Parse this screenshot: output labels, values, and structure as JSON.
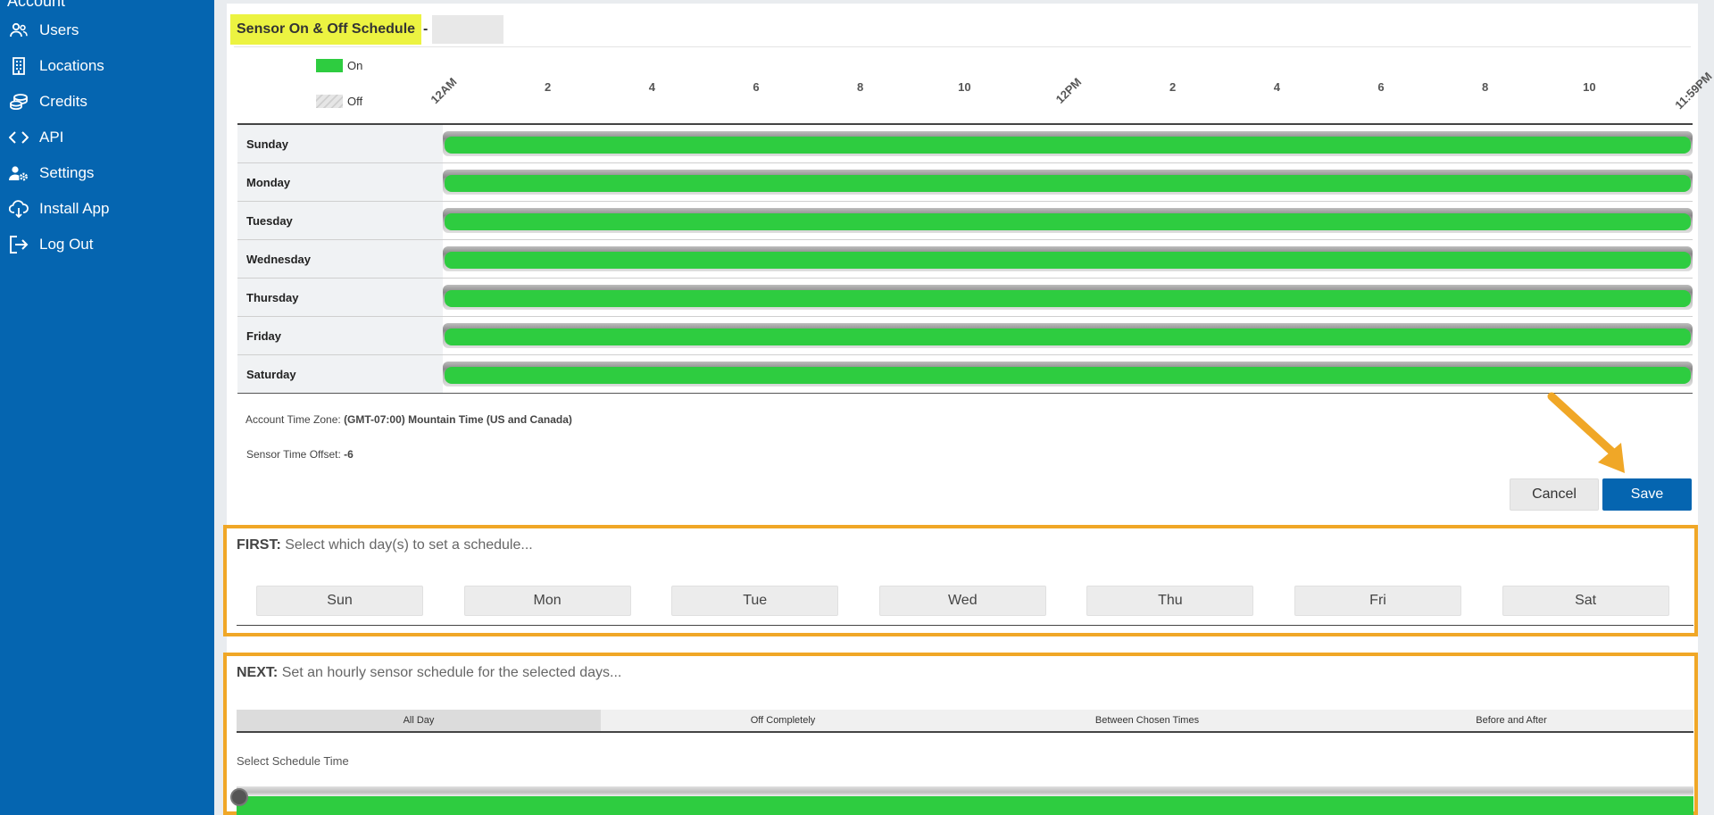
{
  "sidebar": {
    "heading": "Account",
    "items": [
      {
        "label": "Users",
        "icon": "users-icon"
      },
      {
        "label": "Locations",
        "icon": "building-icon"
      },
      {
        "label": "Credits",
        "icon": "coins-icon"
      },
      {
        "label": "API",
        "icon": "code-icon"
      },
      {
        "label": "Settings",
        "icon": "user-gear-icon"
      },
      {
        "label": "Install App",
        "icon": "cloud-download-icon"
      },
      {
        "label": "Log Out",
        "icon": "logout-icon"
      }
    ]
  },
  "schedule": {
    "title": "Sensor On & Off Schedule",
    "title_separator": "-",
    "legend_on": "On",
    "legend_off": "Off",
    "on_color": "#2ecc40",
    "hours": [
      "12AM",
      "2",
      "4",
      "6",
      "8",
      "10",
      "12PM",
      "2",
      "4",
      "6",
      "8",
      "10",
      "11:59PM"
    ],
    "days": [
      {
        "name": "Sunday",
        "on_fraction": 1.0
      },
      {
        "name": "Monday",
        "on_fraction": 1.0
      },
      {
        "name": "Tuesday",
        "on_fraction": 1.0
      },
      {
        "name": "Wednesday",
        "on_fraction": 1.0
      },
      {
        "name": "Thursday",
        "on_fraction": 1.0
      },
      {
        "name": "Friday",
        "on_fraction": 1.0
      },
      {
        "name": "Saturday",
        "on_fraction": 1.0
      }
    ],
    "timezone_label": "Account Time Zone:",
    "timezone_value": "(GMT-07:00) Mountain Time (US and Canada)",
    "offset_label": "Sensor Time Offset:",
    "offset_value": "-6",
    "cancel_label": "Cancel",
    "save_label": "Save"
  },
  "first": {
    "lead": "FIRST:",
    "text": "Select which day(s) to set a schedule...",
    "days": [
      "Sun",
      "Mon",
      "Tue",
      "Wed",
      "Thu",
      "Fri",
      "Sat"
    ]
  },
  "next": {
    "lead": "NEXT:",
    "text": "Set an hourly sensor schedule for the selected days...",
    "tabs": [
      "All Day",
      "Off Completely",
      "Between Chosen Times",
      "Before and After"
    ],
    "active_tab": "All Day",
    "select_label": "Select Schedule Time"
  },
  "colors": {
    "sidebar": "#0565b0",
    "highlight": "#ecf341",
    "callout": "#f0a727",
    "save": "#0565b0"
  }
}
